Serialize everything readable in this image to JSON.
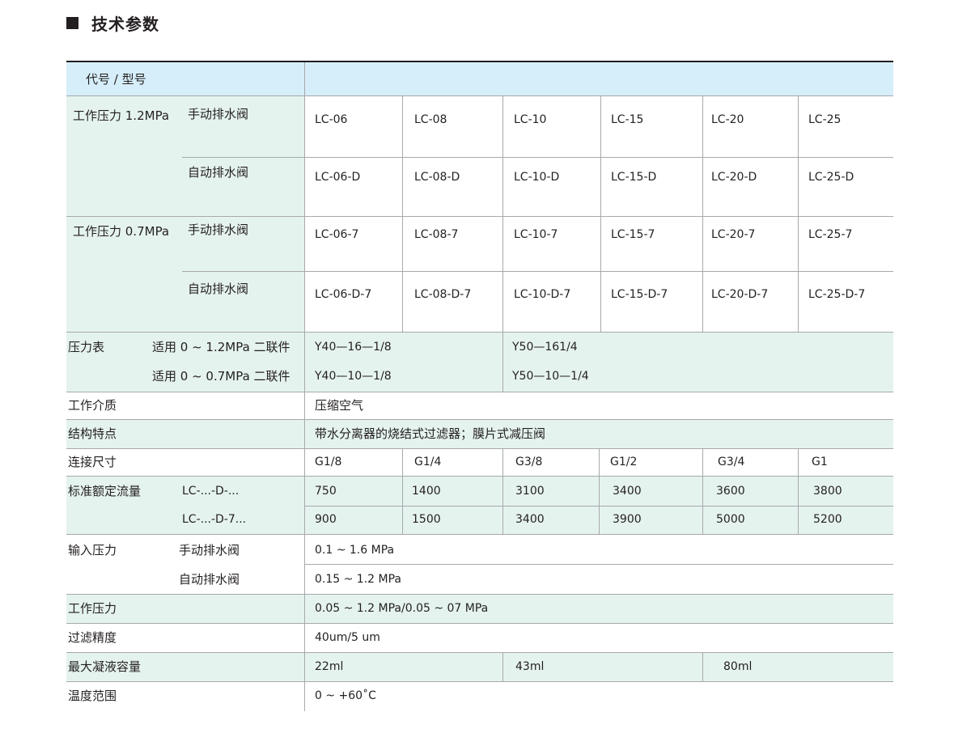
{
  "title": "技术参数",
  "header": {
    "label": "代号 / 型号"
  },
  "models": {
    "p12_label": "工作压力 1.2MPa",
    "p07_label": "工作压力 0.7MPa",
    "manual_label": "手动排水阀",
    "auto_label": "自动排水阀",
    "p12_manual": [
      "LC-06",
      "LC-08",
      "LC-10",
      "LC-15",
      "LC-20",
      "LC-25"
    ],
    "p12_auto": [
      "LC-06-D",
      "LC-08-D",
      "LC-10-D",
      "LC-15-D",
      "LC-20-D",
      "LC-25-D"
    ],
    "p07_manual": [
      "LC-06-7",
      "LC-08-7",
      "LC-10-7",
      "LC-15-7",
      "LC-20-7",
      "LC-25-7"
    ],
    "p07_auto": [
      "LC-06-D-7",
      "LC-08-D-7",
      "LC-10-D-7",
      "LC-15-D-7",
      "LC-20-D-7",
      "LC-25-D-7"
    ]
  },
  "gauge": {
    "label": "压力表",
    "row1_sub": "适用 0 ~ 1.2MPa 二联件",
    "row2_sub": "适用 0 ~ 0.7MPa 二联件",
    "row1_values": [
      "Y40—16—1/8",
      "Y50—161/4"
    ],
    "row2_values": [
      "Y40—10—1/8",
      "Y50—10—1/4"
    ]
  },
  "medium": {
    "label": "工作介质",
    "value": "压缩空气"
  },
  "structure": {
    "label": "结构特点",
    "value": "带水分离器的烧结式过滤器；膜片式减压阀"
  },
  "connection": {
    "label": "连接尺寸",
    "values": [
      "G1/8",
      "G1/4",
      "G3/8",
      "G1/2",
      "G3/4",
      "G1"
    ]
  },
  "flow": {
    "label": "标准额定流量",
    "row1_sub": "LC-...-D-...",
    "row2_sub": "LC-...-D-7...",
    "row1_values": [
      "750",
      "1400",
      "3100",
      "3400",
      "3600",
      "3800"
    ],
    "row2_values": [
      "900",
      "1500",
      "3400",
      "3900",
      "5000",
      "5200"
    ]
  },
  "input": {
    "label": "输入压力",
    "row1_sub": "手动排水阀",
    "row2_sub": "自动排水阀",
    "row1_value": "0.1 ~ 1.6 MPa",
    "row2_value": "0.15 ~ 1.2 MPa"
  },
  "working": {
    "label": "工作压力",
    "value": "0.05 ~ 1.2 MPa/0.05 ~ 07 MPa"
  },
  "filtration": {
    "label": "过滤精度",
    "value": "40um/5 um"
  },
  "condensate": {
    "label": "最大凝液容量",
    "values": [
      "22ml",
      "43ml",
      "80ml"
    ]
  },
  "temperature": {
    "label": "温度范围",
    "value": "0 ~ +60˚C"
  },
  "colors": {
    "header_bg": "#d6eef9",
    "shade_bg": "#e5f3ef",
    "rule": "#a7a9ac",
    "text": "#231f20"
  }
}
